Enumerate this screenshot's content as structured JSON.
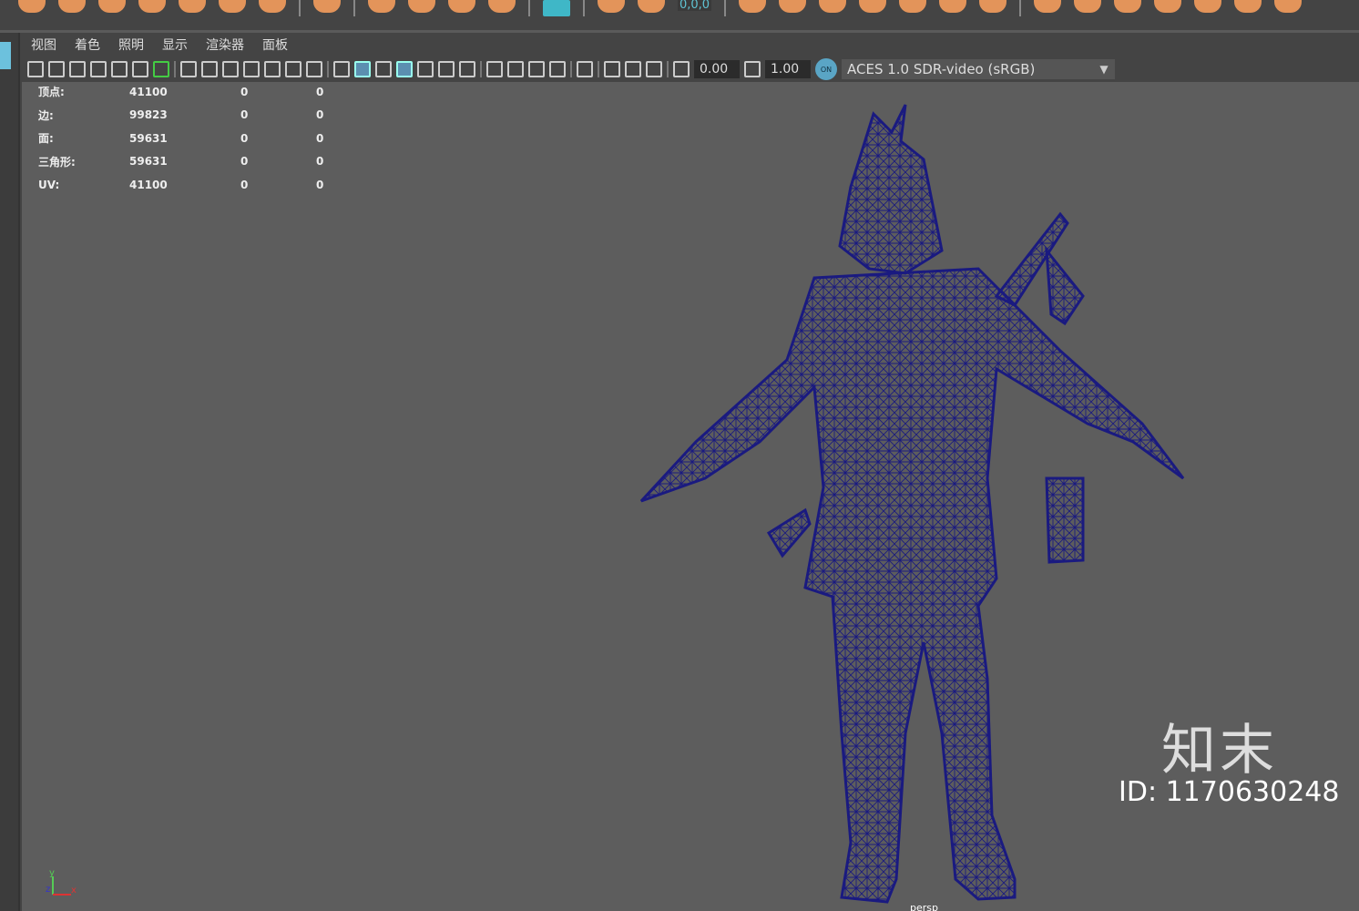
{
  "shelf": {
    "icons": [
      "orange",
      "orange",
      "orange",
      "orange",
      "orange",
      "orange",
      "orange",
      "sep",
      "orange",
      "sep",
      "orange",
      "orange",
      "orange",
      "orange",
      "sep",
      "teal",
      "sep",
      "orange",
      "orange",
      "sep",
      "orange",
      "orange",
      "orange",
      "orange",
      "orange",
      "orange",
      "orange",
      "sep",
      "orange",
      "orange",
      "orange",
      "orange",
      "orange",
      "orange",
      "orange"
    ],
    "coord_text": "0,0,0"
  },
  "panel_menu": [
    "视图",
    "着色",
    "照明",
    "显示",
    "渲染器",
    "面板"
  ],
  "panel_toolbar": {
    "icons": [
      "camera-icon",
      "lock-camera-icon",
      "camera-attr-icon",
      "bookmark-icon",
      "image-plane-icon",
      "2d-pan-zoom-icon",
      "grease-pencil-icon",
      "sep",
      "grid-icon",
      "film-gate-icon",
      "resolution-gate-icon",
      "gate-mask-icon",
      "field-chart-icon",
      "safe-action-icon",
      "safe-title-icon",
      "sep",
      "wireframe-icon",
      "smooth-shade-icon",
      "default-material-icon",
      "wireframe-on-shaded-icon",
      "xray-icon",
      "lights-icon",
      "shadows-icon",
      "sep",
      "screen-space-ao-icon",
      "motion-blur-icon",
      "multisample-aa-icon",
      "depth-of-field-icon",
      "sep",
      "isolate-select-icon",
      "sep",
      "xray-joints-icon",
      "xray-active-icon",
      "backface-icon",
      "sep"
    ],
    "exposure": "0.00",
    "gamma": "1.00",
    "color_mgmt_on": "ON",
    "color_space": "ACES 1.0 SDR-video (sRGB)"
  },
  "hud": {
    "rows": [
      {
        "label": "顶点:",
        "v1": "41100",
        "v2": "0",
        "v3": "0"
      },
      {
        "label": "边:",
        "v1": "99823",
        "v2": "0",
        "v3": "0"
      },
      {
        "label": "面:",
        "v1": "59631",
        "v2": "0",
        "v3": "0"
      },
      {
        "label": "三角形:",
        "v1": "59631",
        "v2": "0",
        "v3": "0"
      },
      {
        "label": "UV:",
        "v1": "41100",
        "v2": "0",
        "v3": "0"
      }
    ]
  },
  "viewport": {
    "camera": "persp",
    "axes": {
      "x": "x",
      "y": "y",
      "z": "z"
    },
    "wire_color": "#1a1a80",
    "bg_color": "#5d5d5d"
  },
  "watermark": {
    "logo": "知末",
    "id": "ID: 1170630248"
  }
}
